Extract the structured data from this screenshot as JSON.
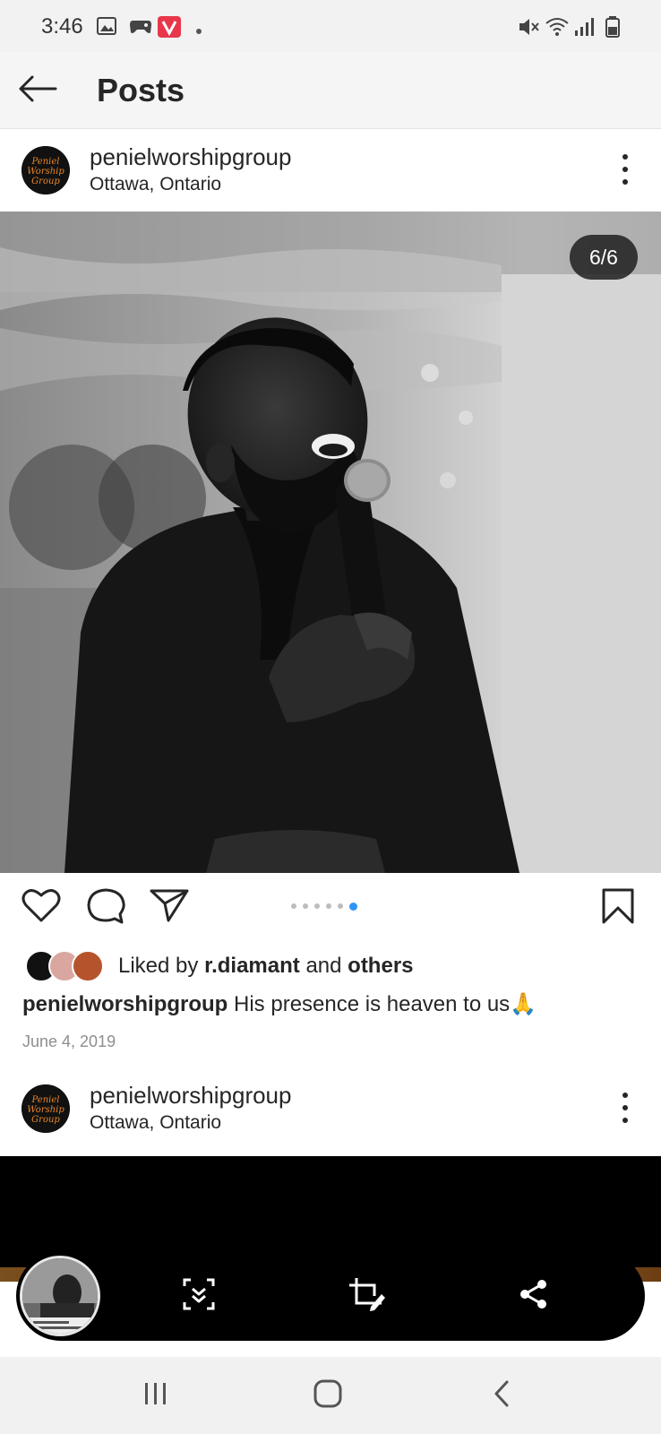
{
  "status_bar": {
    "time": "3:46",
    "notification_icons": [
      "image-icon",
      "gamepad-icon",
      "v-app-icon",
      "more-dot-icon"
    ],
    "system_icons": [
      "mute-icon",
      "wifi-icon",
      "signal-icon",
      "battery-icon"
    ]
  },
  "app_bar": {
    "title": "Posts",
    "back_icon": "arrow-left-icon"
  },
  "post": {
    "username": "penielworshipgroup",
    "location": "Ottawa, Ontario",
    "avatar_text": "Peniel Worship Group",
    "image_counter": "6/6",
    "carousel": {
      "count": 6,
      "active": 6
    },
    "liked_by_prefix": "Liked by",
    "liked_by_user": "r.diamant",
    "liked_by_and": "and",
    "liked_by_others": "others",
    "caption_user": "penielworshipgroup",
    "caption_text": "His presence is heaven to us🙏",
    "date": "June 4, 2019"
  },
  "next_post": {
    "username": "penielworshipgroup",
    "location": "Ottawa, Ontario",
    "avatar_text": "Peniel Worship Group"
  },
  "capture_toolbar": {
    "buttons": [
      "scroll-capture-icon",
      "crop-edit-icon",
      "share-icon"
    ]
  },
  "nav_bar": {
    "buttons": [
      "recents-icon",
      "home-icon",
      "back-icon"
    ]
  },
  "colors": {
    "accent_blue": "#2f95f6",
    "logo_orange": "#e8862a",
    "text": "#262626",
    "date_gray": "#8e8e8e"
  }
}
